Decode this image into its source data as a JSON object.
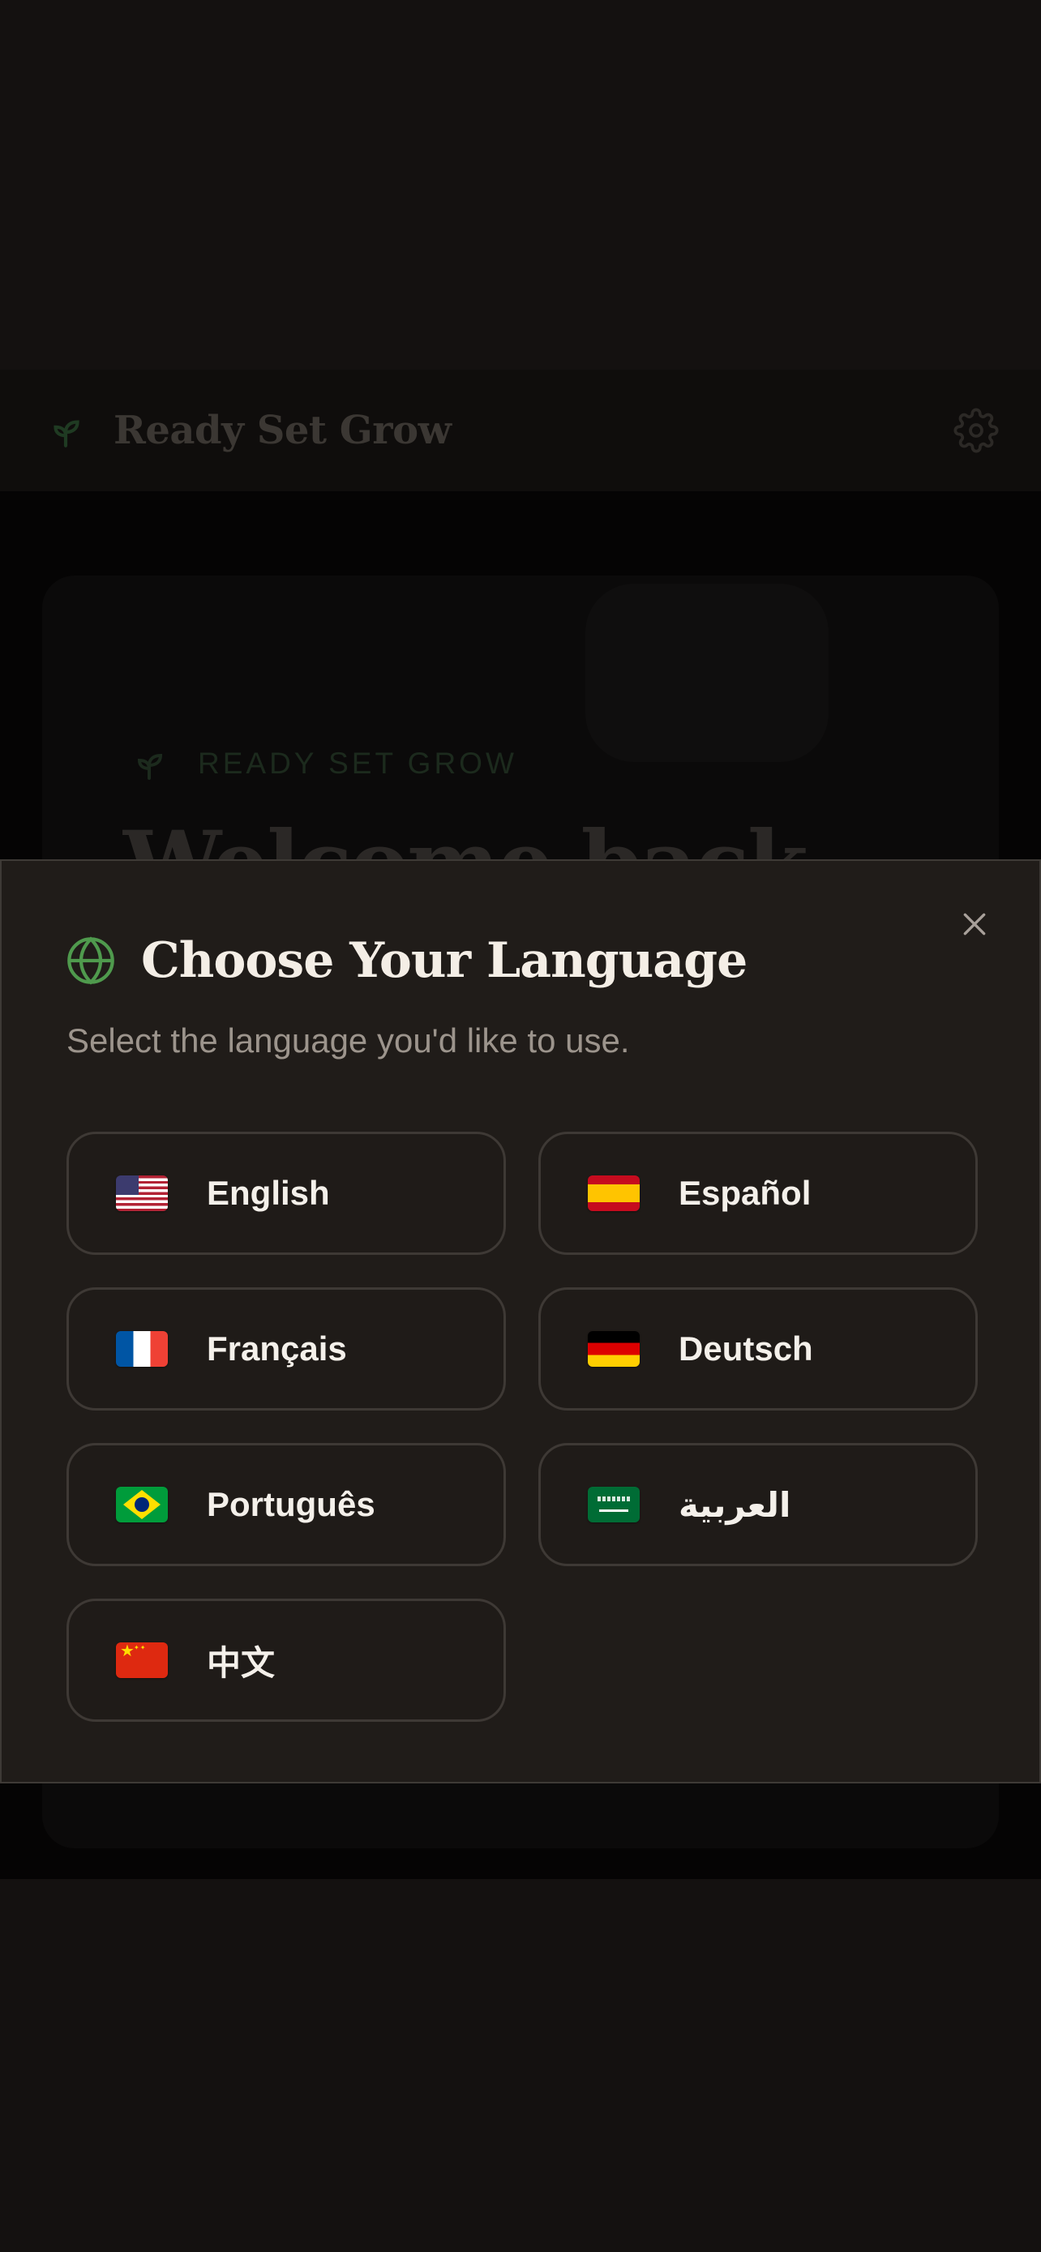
{
  "app": {
    "brand_name": "Ready Set Grow"
  },
  "hero": {
    "eyebrow": "READY SET GROW",
    "title": "Welcome back,"
  },
  "modal": {
    "title": "Choose Your Language",
    "subtitle": "Select the language you'd like to use.",
    "languages": [
      {
        "label": "English",
        "flag": "flag-us"
      },
      {
        "label": "Español",
        "flag": "flag-es"
      },
      {
        "label": "Français",
        "flag": "flag-fr"
      },
      {
        "label": "Deutsch",
        "flag": "flag-de"
      },
      {
        "label": "Português",
        "flag": "flag-br"
      },
      {
        "label": "العربية",
        "flag": "flag-sa"
      },
      {
        "label": "中文",
        "flag": "flag-cn"
      }
    ]
  },
  "colors": {
    "accent_green": "#4f9a4d",
    "modal_bg": "#201c19",
    "page_bg": "#141110"
  }
}
